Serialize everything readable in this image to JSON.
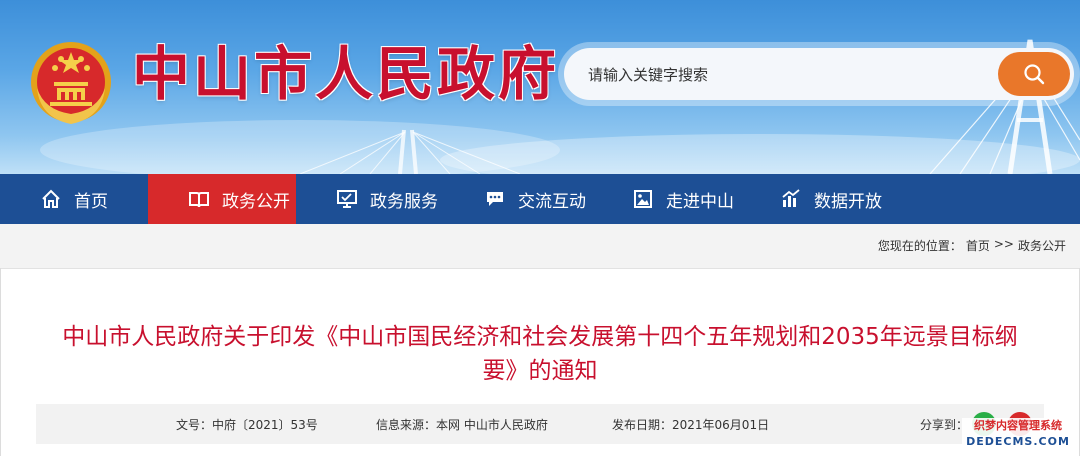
{
  "header": {
    "site_title": "中山市人民政府",
    "search_placeholder": "请输入关键字搜索",
    "emblem_icon": "national-emblem-icon",
    "search_icon": "search-icon"
  },
  "nav": {
    "items": [
      {
        "label": "首页",
        "icon": "home-icon",
        "active": false
      },
      {
        "label": "政务公开",
        "icon": "book-icon",
        "active": true
      },
      {
        "label": "政务服务",
        "icon": "monitor-icon",
        "active": false
      },
      {
        "label": "交流互动",
        "icon": "chat-icon",
        "active": false
      },
      {
        "label": "走进中山",
        "icon": "picture-icon",
        "active": false
      },
      {
        "label": "数据开放",
        "icon": "bar-chart-icon",
        "active": false
      }
    ]
  },
  "breadcrumb": {
    "prefix": "您现在的位置：",
    "home": "首页",
    "separator": ">>",
    "current": "政务公开"
  },
  "article": {
    "title_line1": "中山市人民政府关于印发《中山市国民经济和社会发展第十四个五年规划和2035年远景目标纲",
    "title_line2": "要》的通知",
    "doc_number": "文号：中府〔2021〕53号",
    "source": "信息来源：本网 中山市人民政府",
    "publish_date": "发布日期：2021年06月01日",
    "share_label": "分享到："
  },
  "watermark": {
    "line1": "织梦内容管理系统",
    "line2": "DEDECMS.COM"
  },
  "colors": {
    "brand_red": "#c8102e",
    "nav_blue": "#1d4f95",
    "nav_active": "#d7292b",
    "search_button": "#e9772a"
  }
}
